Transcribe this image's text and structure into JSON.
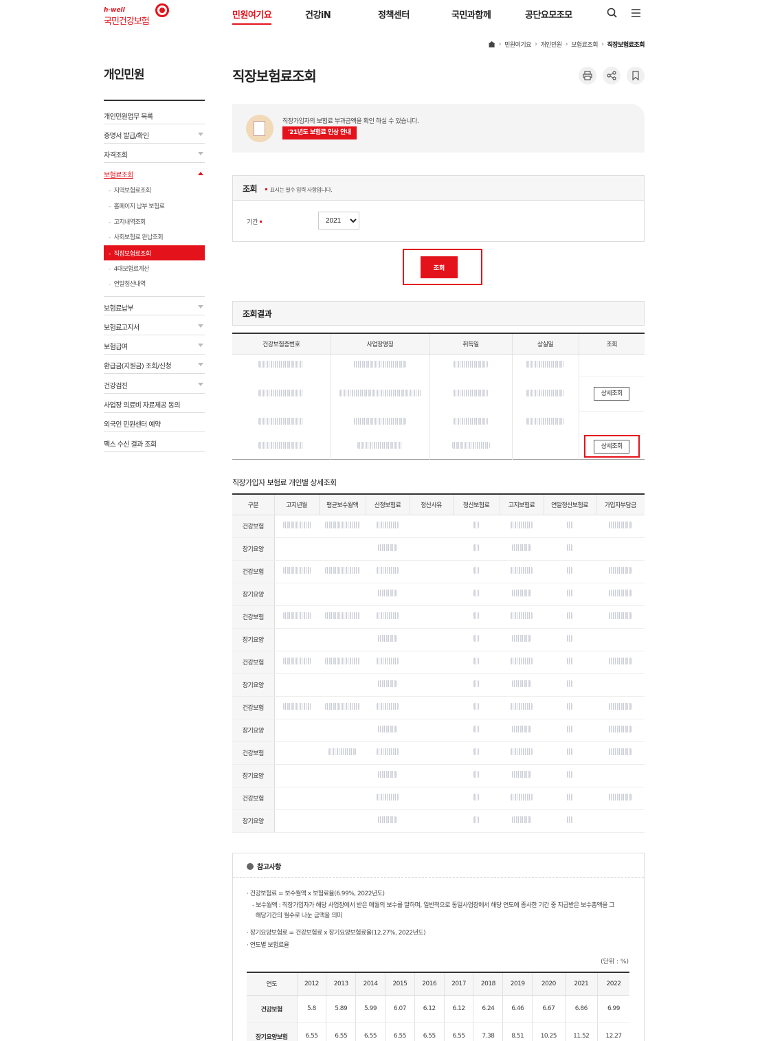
{
  "header": {
    "logo_small": "h-well",
    "logo_text": "국민건강보험",
    "gnb": [
      "민원여기요",
      "건강iN",
      "정책센터",
      "국민과함께",
      "공단요모조모"
    ]
  },
  "breadcrumb": [
    "민원여기요",
    "개인민원",
    "보험료조회",
    "직장보험료조회"
  ],
  "lnb": {
    "title": "개인민원",
    "items": [
      "개인민원업무 목록",
      "증명서 발급/확인",
      "자격조회",
      "보험료조회",
      "보험료납부",
      "보험료고지서",
      "보험급여",
      "환급금(지원금) 조회/신청",
      "건강검진",
      "사업장 의료비 자료제공 동의",
      "외국인 민원센터 예약",
      "팩스 수신 결과 조회"
    ],
    "sub": [
      "지역보험료조회",
      "홈페이지 납부 보험료",
      "고지내역조회",
      "사회보험료 완납조회",
      "직장보험료조회",
      "4대보험료계산",
      "연말정산내역"
    ]
  },
  "page": {
    "title": "직장보험료조회",
    "info_text": "직장가입자의 보험료 부과금액을 확인 하실 수 있습니다.",
    "info_button": "'21년도 보험료 인상 안내"
  },
  "search": {
    "title": "조회",
    "required_note": "표시는 필수 입력 사항입니다.",
    "period_label": "기간",
    "period_value": "2021",
    "button": "조회"
  },
  "results": {
    "title": "조회결과",
    "headers": [
      "건강보험증번호",
      "사업장명칭",
      "취득일",
      "상실일",
      "조회"
    ],
    "detail_button": "상세조회"
  },
  "detail": {
    "title": "직장가입자 보험료 개인별 상세조회",
    "headers": [
      "구분",
      "고지년월",
      "평균보수월액",
      "산정보험료",
      "정산사유",
      "정산보험료",
      "고지보험료",
      "연말정산보험료",
      "가입자부담금"
    ],
    "rows": [
      "건강보험",
      "장기요양",
      "건강보험",
      "장기요양",
      "건강보험",
      "장기요양",
      "건강보험",
      "장기요양",
      "건강보험",
      "장기요양",
      "건강보험",
      "장기요양",
      "건강보험",
      "장기요양"
    ]
  },
  "notes": {
    "title": "참고사항",
    "line1": "건강보험료 = 보수월액 x 보험료율(6.99%, 2022년도)",
    "line2a": "보수월액 : 직장가입자가 해당 사업장에서 받은 매월의 보수를 말하며, 일반적으로 동일사업장에서 해당 연도에 종사한 기간 중 지급받은 보수총액을 그",
    "line2b": "해당기간의 월수로 나눈 금액을 의미",
    "line3": "장기요양보험료 = 건강보험료 x 장기요양보험료율(12.27%, 2022년도)",
    "line4": "연도별 보험료율",
    "unit": "(단위 : %)",
    "rate_headers": [
      "연도",
      "2012",
      "2013",
      "2014",
      "2015",
      "2016",
      "2017",
      "2018",
      "2019",
      "2020",
      "2021",
      "2022"
    ],
    "health_label": "건강보험",
    "health": [
      "5.8",
      "5.89",
      "5.99",
      "6.07",
      "6.12",
      "6.12",
      "6.24",
      "6.46",
      "6.67",
      "6.86",
      "6.99"
    ],
    "ltc_label": "장기요양보험",
    "ltc": [
      "6.55",
      "6.55",
      "6.55",
      "6.55",
      "6.55",
      "6.55",
      "7.38",
      "8.51",
      "10.25",
      "11.52",
      "12.27"
    ]
  }
}
